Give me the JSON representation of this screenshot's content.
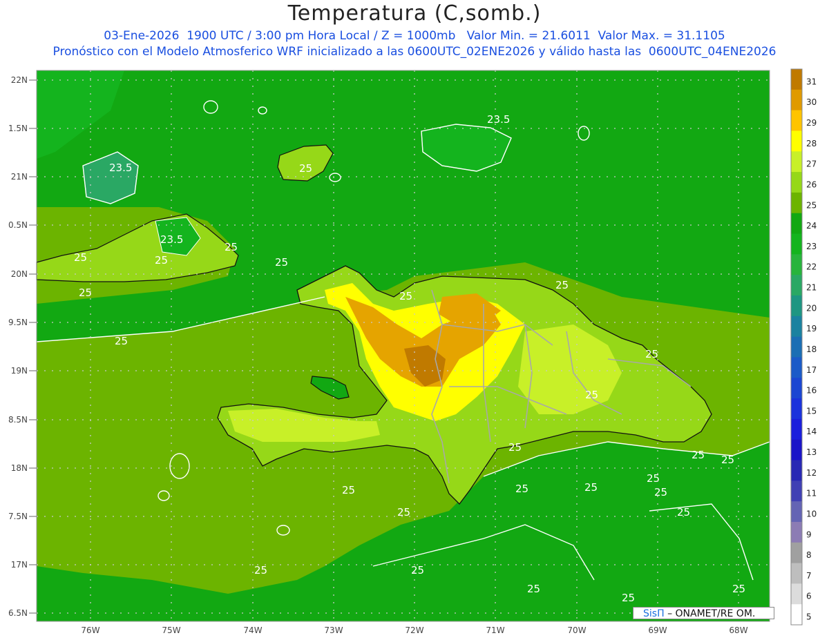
{
  "header": {
    "title": "Temperatura (C,somb.)",
    "line1": "03-Ene-2026  1900 UTC / 3:00 pm Hora Local / Z = 1000mb   Valor Min. = 21.6011  Valor Max. = 31.1105",
    "line2": "Pronóstico con el Modelo Atmosferico WRF inicializado a las 0600UTC_02ENE2026 y válido hasta las  0600UTC_04ENE2026"
  },
  "axes": {
    "lat_labels": [
      "22N",
      "1.5N",
      "21N",
      "0.5N",
      "20N",
      "9.5N",
      "19N",
      "8.5N",
      "18N",
      "7.5N",
      "17N",
      "6.5N"
    ],
    "lon_labels": [
      "76W",
      "75W",
      "74W",
      "73W",
      "72W",
      "71W",
      "70W",
      "69W",
      "68W"
    ]
  },
  "colorbar": {
    "labels": [
      "31",
      "30",
      "29",
      "28",
      "27",
      "26",
      "25",
      "24",
      "23",
      "22",
      "21",
      "20",
      "19",
      "18",
      "17",
      "16",
      "15",
      "14",
      "13",
      "12",
      "11",
      "10",
      "9",
      "8",
      "7",
      "6",
      "5"
    ],
    "colors": [
      "#c07a00",
      "#e09a00",
      "#ffc400",
      "#ffff00",
      "#c8f028",
      "#96d818",
      "#6cb400",
      "#12a812",
      "#14b41e",
      "#28b43c",
      "#2aa864",
      "#1e9682",
      "#1a82a0",
      "#1a6eb4",
      "#1a5ac8",
      "#1a46d2",
      "#1a32dc",
      "#1a1edc",
      "#1a14c8",
      "#2828b4",
      "#4040b4",
      "#6464b4",
      "#8c7cb4",
      "#a0a0a0",
      "#bebebe",
      "#dcdcdc",
      "#ffffff"
    ]
  },
  "contour_labels": [
    "23.5",
    "23.5",
    "23.5",
    "25",
    "25",
    "25",
    "25",
    "25",
    "25",
    "25",
    "25",
    "25",
    "25",
    "25",
    "25",
    "25",
    "25",
    "25",
    "25",
    "25",
    "25",
    "25",
    "25",
    "25",
    "25",
    "25",
    "25",
    "25",
    "25"
  ],
  "colors": {
    "ocean": "#12a812",
    "land_26": "#96d818",
    "warm_28": "#ffff00",
    "hot_29": "#e5a400",
    "hot_30": "#c07a00",
    "cool_23": "#14b41e",
    "cool_22": "#2aa864"
  },
  "credit": {
    "brand": "SisΠ",
    "text": "– ONAMET/RE   OM."
  }
}
